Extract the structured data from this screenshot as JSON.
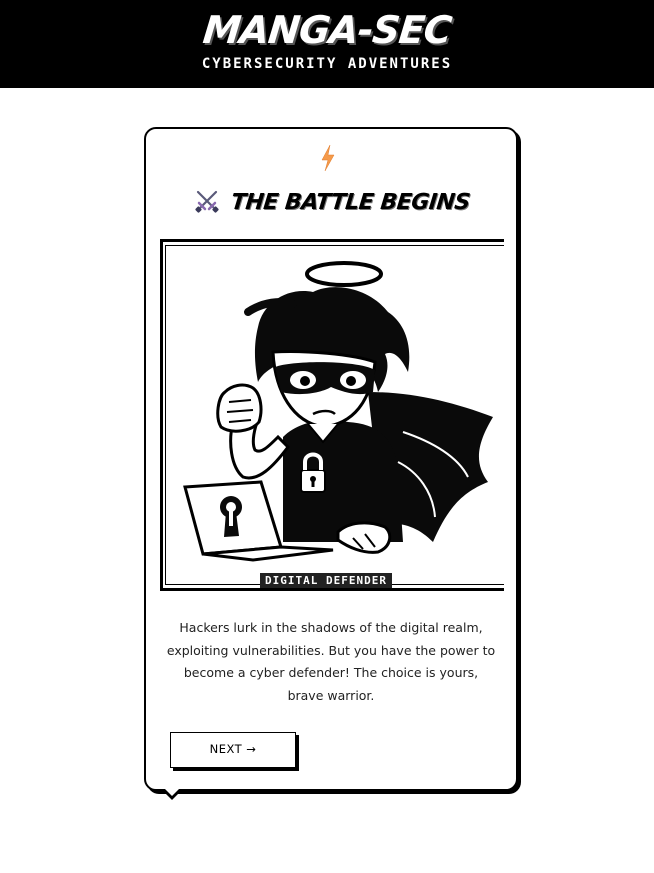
{
  "header": {
    "brand": "MANGA-SEC",
    "tagline": "CYBERSECURITY ADVENTURES",
    "background": "#000000"
  },
  "card": {
    "top_icon": "lightning-bolt-icon",
    "title_icon": "crossed-swords-icon",
    "title": "THE BATTLE BEGINS",
    "panel": {
      "image": "hero-character-with-laptop-illustration",
      "caption": "DIGITAL DEFENDER"
    },
    "story": "Hackers lurk in the shadows of the digital realm, exploiting vulnerabilities. But you have the power to become a cyber defender! The choice is yours, brave warrior.",
    "next_button": {
      "label": "NEXT",
      "arrow": "→"
    }
  },
  "colors": {
    "accent_bolt": "#f59a4a",
    "ink": "#000000",
    "paper": "#ffffff"
  }
}
